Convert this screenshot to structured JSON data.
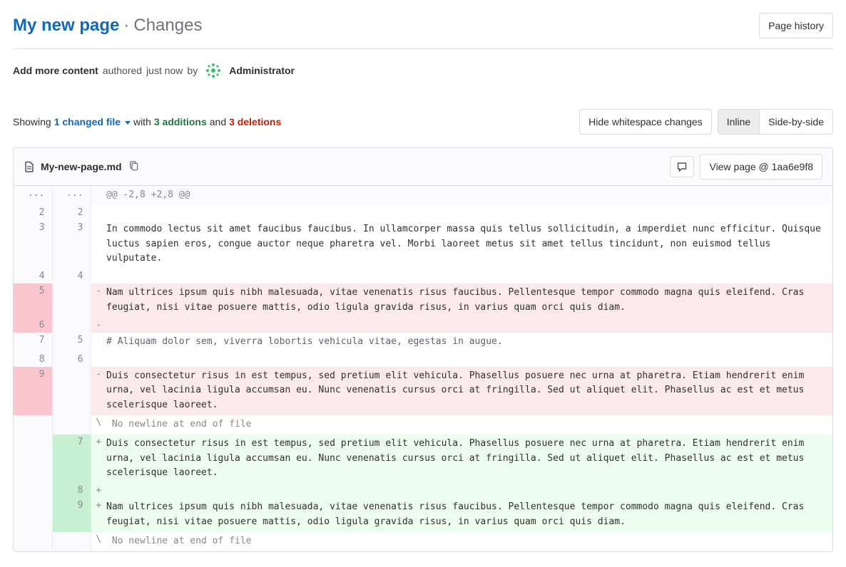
{
  "header": {
    "page_link": "My new page",
    "separator": "·",
    "section": "Changes",
    "history_button": "Page history"
  },
  "commit": {
    "title": "Add more content",
    "authored": "authored",
    "timeago": "just now",
    "by": "by",
    "author": "Administrator"
  },
  "stats": {
    "showing": "Showing",
    "changed_files": "1 changed file",
    "with": "with",
    "additions": "3 additions",
    "and": "and",
    "deletions": "3 deletions"
  },
  "controls": {
    "whitespace": "Hide whitespace changes",
    "inline": "Inline",
    "sidebyside": "Side-by-side"
  },
  "file": {
    "name": "My-new-page.md",
    "view_button": "View page @ 1aa6e9f8"
  },
  "diff": {
    "hunk_old": "...",
    "hunk_new": "...",
    "hunk_header": "@@ -2,8 +2,8 @@",
    "lines": [
      {
        "type": "ctx",
        "old": "2",
        "new": "2",
        "sign": " ",
        "text": ""
      },
      {
        "type": "ctx",
        "old": "3",
        "new": "3",
        "sign": " ",
        "text": "In commodo lectus sit amet faucibus faucibus. In ullamcorper massa quis tellus sollicitudin, a imperdiet nunc efficitur. Quisque luctus sapien eros, congue auctor neque pharetra vel. Morbi laoreet metus sit amet tellus tincidunt, non euismod tellus vulputate."
      },
      {
        "type": "ctx",
        "old": "4",
        "new": "4",
        "sign": " ",
        "text": ""
      },
      {
        "type": "del",
        "old": "5",
        "new": "",
        "sign": "-",
        "text": "Nam ultrices ipsum quis nibh malesuada, vitae venenatis risus faucibus. Pellentesque tempor commodo magna quis eleifend. Cras feugiat, nisi vitae posuere mattis, odio ligula gravida risus, in varius quam orci quis diam."
      },
      {
        "type": "del",
        "old": "6",
        "new": "",
        "sign": "-",
        "text": ""
      },
      {
        "type": "ctx",
        "old": "7",
        "new": "5",
        "sign": " ",
        "text": "# Aliquam dolor sem, viverra lobortis vehicula vitae, egestas in augue."
      },
      {
        "type": "ctx",
        "old": "8",
        "new": "6",
        "sign": " ",
        "text": ""
      },
      {
        "type": "del",
        "old": "9",
        "new": "",
        "sign": "-",
        "text": "Duis consectetur risus in est tempus, sed pretium elit vehicula. Phasellus posuere nec urna at pharetra. Etiam hendrerit enim urna, vel lacinia ligula accumsan eu. Nunc venenatis cursus orci at fringilla. Sed ut aliquet elit. Phasellus ac est et metus scelerisque laoreet."
      },
      {
        "type": "meta",
        "old": "",
        "new": "",
        "sign": "\\",
        "text": " No newline at end of file"
      },
      {
        "type": "add",
        "old": "",
        "new": "7",
        "sign": "+",
        "text": "Duis consectetur risus in est tempus, sed pretium elit vehicula. Phasellus posuere nec urna at pharetra. Etiam hendrerit enim urna, vel lacinia ligula accumsan eu. Nunc venenatis cursus orci at fringilla. Sed ut aliquet elit. Phasellus ac est et metus scelerisque laoreet."
      },
      {
        "type": "add",
        "old": "",
        "new": "8",
        "sign": "+",
        "text": ""
      },
      {
        "type": "add",
        "old": "",
        "new": "9",
        "sign": "+",
        "text": "Nam ultrices ipsum quis nibh malesuada, vitae venenatis risus faucibus. Pellentesque tempor commodo magna quis eleifend. Cras feugiat, nisi vitae posuere mattis, odio ligula gravida risus, in varius quam orci quis diam."
      },
      {
        "type": "meta",
        "old": "",
        "new": "",
        "sign": "\\",
        "text": " No newline at end of file"
      }
    ]
  }
}
